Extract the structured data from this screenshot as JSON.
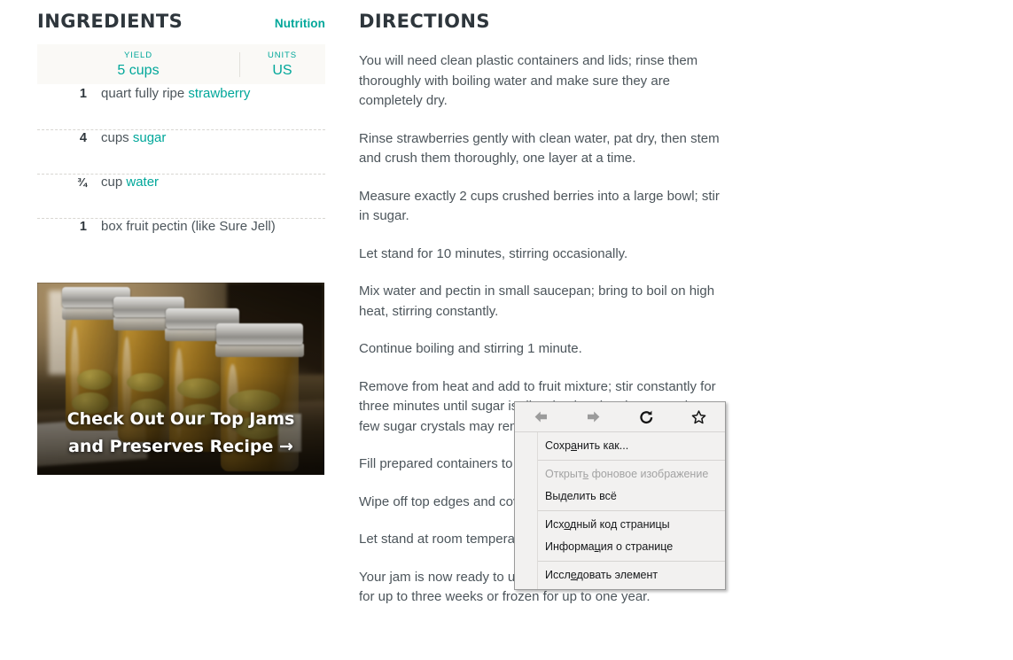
{
  "ingredients": {
    "title": "INGREDIENTS",
    "nutrition_label": "Nutrition",
    "yield": {
      "label": "YIELD",
      "value": "5 cups"
    },
    "units": {
      "label": "UNITS",
      "value": "US"
    },
    "items": [
      {
        "qty": "1",
        "text_before": "quart fully ripe ",
        "link": "strawberry",
        "text_after": ""
      },
      {
        "qty": "4",
        "text_before": "cups ",
        "link": "sugar",
        "text_after": ""
      },
      {
        "qty": "¾",
        "text_before": "cup ",
        "link": "water",
        "text_after": ""
      },
      {
        "qty": "1",
        "text_before": "box fruit pectin (like Sure Jell)",
        "link": "",
        "text_after": ""
      }
    ]
  },
  "promo": {
    "caption": "Check Out Our Top Jams and Preserves Recipe →",
    "image_alt": "mason-jars-of-preserves-photo"
  },
  "directions": {
    "title": "DIRECTIONS",
    "paragraphs": [
      "You will need clean plastic containers and lids; rinse them thoroughly with boiling water and make sure they are completely dry.",
      "Rinse strawberries gently with clean water, pat dry, then stem and crush them thoroughly, one layer at a time.",
      "Measure exactly 2 cups crushed berries into a large bowl; stir in sugar.",
      "Let stand for 10 minutes, stirring occasionally.",
      "Mix water and pectin in small saucepan; bring to boil on high heat, stirring constantly.",
      "Continue boiling and stirring 1 minute.",
      "Remove from heat and add to fruit mixture; stir constantly for three minutes until sugar is dissolved and no longer grainy; a few sugar crystals may remain and that's ok.",
      "Fill prepared containers to within 1/2 inch of tops.",
      "Wipe off top edges and cover with lids.",
      "Let stand at room temperature 24 hours.",
      "Your jam is now ready to use, and can be stored in the fridge for up to three weeks or frozen for up to one year."
    ]
  },
  "context_menu": {
    "nav": [
      {
        "name": "back",
        "icon": "arrow-left-icon",
        "enabled": false
      },
      {
        "name": "forward",
        "icon": "arrow-right-icon",
        "enabled": false
      },
      {
        "name": "reload",
        "icon": "reload-icon",
        "enabled": true
      },
      {
        "name": "bookmark",
        "icon": "star-icon",
        "enabled": true
      }
    ],
    "groups": [
      [
        {
          "label": "Сохранить как...",
          "accel_index": 4,
          "disabled": false
        }
      ],
      [
        {
          "label": "Открыть фоновое изображение",
          "accel_index": 6,
          "disabled": true
        },
        {
          "label": "Выделить всё",
          "accel_index": 2,
          "disabled": false
        }
      ],
      [
        {
          "label": "Исходный код страницы",
          "accel_index": 3,
          "disabled": false
        },
        {
          "label": "Информация о странице",
          "accel_index": 7,
          "disabled": false
        }
      ],
      [
        {
          "label": "Исследовать элемент",
          "accel_index": 4,
          "disabled": false
        }
      ]
    ]
  },
  "colors": {
    "accent_teal": "#00a79a",
    "text_dark": "#2e363c",
    "text_body": "#4c555b",
    "panel_cream": "#faf9f6",
    "menu_bg": "#f2f1f0"
  }
}
